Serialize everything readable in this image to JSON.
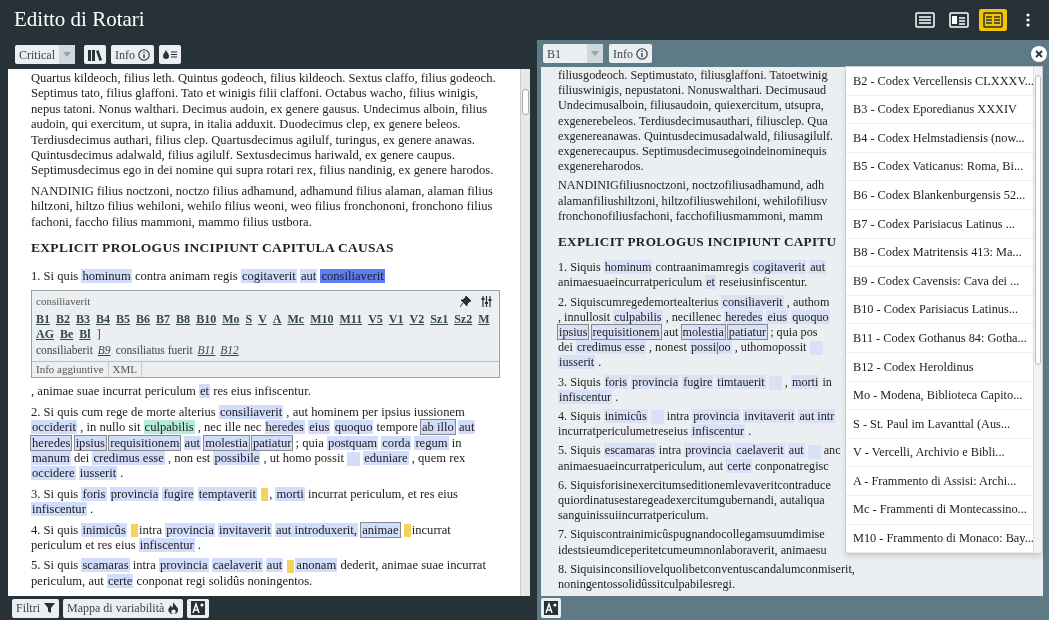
{
  "window": {
    "title": "Editto di Rotari"
  },
  "view_modes": [
    {
      "kind": "text",
      "selected": false
    },
    {
      "kind": "image-text",
      "selected": false
    },
    {
      "kind": "parallel",
      "selected": true
    }
  ],
  "left_panel": {
    "edition_select": "Critical",
    "info_button": "Info",
    "paragraphs": [
      {
        "kind": "para",
        "segments": [
          {
            "kind": "plain",
            "text": "Quartus kildeoch, filius leth. Quintus godeoch, filius kildeoch. Sextus claffo, filius godeoch. Septimus tato, filius glaffoni. Tato et winigis filii claffoni. Octabus wacho, filius winigis, nepus tatoni. Nonus walthari. Decimus audoin, ex genere gausus. Undecimus alboin, filius audoin, qui exercitum, ut supra, in italia adduxit. Duodecimus clep, ex genere beleos. Terdiusdecimus authari, filius clep. Quartusdecimus agilulf, turingus, ex genere anawas. Quintusdecimus adalwald, filius agilulf. Sextusdecimus hariwald, ex genere caupus. Septimusdecimus ego in dei nomine qui supra rotari rex, filius nandinig, ex genere harodos."
          }
        ]
      },
      {
        "kind": "para",
        "segments": [
          {
            "kind": "plain",
            "text": "NANDINIG filius noctzoni, noctzo filius adhamund, adhamund filius alaman, alaman filius hiltzoni, hiltzo filius wehiloni, wehilo filius weoni, weo filius fronchononi, fronchono filius fachoni, faccho filius mammoni, mammo filius ustbora."
          }
        ]
      },
      {
        "kind": "heading",
        "segments": [
          {
            "kind": "plain",
            "text": "EXPLICIT PROLOGUS INCIPIUNT CAPITULA CAUSAS"
          }
        ]
      },
      {
        "kind": "para",
        "segments": [
          {
            "kind": "plain",
            "text": "1. Si quis "
          },
          {
            "kind": "hl",
            "text": "hominum"
          },
          {
            "kind": "plain",
            "text": " contra animam regis "
          },
          {
            "kind": "hl",
            "text": "cogitaverit"
          },
          {
            "kind": "space"
          },
          {
            "kind": "hl",
            "text": "aut"
          },
          {
            "kind": "space"
          },
          {
            "kind": "selected",
            "text": "consiliaverit"
          }
        ]
      },
      {
        "kind": "popup"
      },
      {
        "kind": "para",
        "segments": [
          {
            "kind": "plain",
            "text": ", animae suae incurrat periculum "
          },
          {
            "kind": "hl",
            "text": "et"
          },
          {
            "kind": "plain",
            "text": " res eius infiscentur."
          }
        ]
      },
      {
        "kind": "para",
        "segments": [
          {
            "kind": "plain",
            "text": "2. Si quis cum rege de morte alterius "
          },
          {
            "kind": "hl",
            "text": "consiliaverit"
          },
          {
            "kind": "plain",
            "text": " , aut hominem per ipsius iussionem "
          },
          {
            "kind": "hl",
            "text": "occiderit"
          },
          {
            "kind": "plain",
            "text": " , in nullo sit "
          },
          {
            "kind": "green",
            "text": "culpabilis"
          },
          {
            "kind": "plain",
            "text": " , nec ille nec "
          },
          {
            "kind": "hl",
            "text": "heredes"
          },
          {
            "kind": "space"
          },
          {
            "kind": "hl",
            "text": "eius"
          },
          {
            "kind": "space"
          },
          {
            "kind": "hl",
            "text": "quoquo"
          },
          {
            "kind": "plain",
            "text": " tempore "
          },
          {
            "kind": "boxed",
            "text": "ab illo"
          },
          {
            "kind": "space"
          },
          {
            "kind": "hl",
            "text": "aut"
          },
          {
            "kind": "space"
          },
          {
            "kind": "boxed",
            "text": "heredes"
          },
          {
            "kind": "space"
          },
          {
            "kind": "boxed",
            "text": "ipsius"
          },
          {
            "kind": "space"
          },
          {
            "kind": "boxed",
            "text": "requisitionem"
          },
          {
            "kind": "space"
          },
          {
            "kind": "hl",
            "text": "aut"
          },
          {
            "kind": "space"
          },
          {
            "kind": "boxed",
            "text": "molestia"
          },
          {
            "kind": "space"
          },
          {
            "kind": "boxed",
            "text": "patiatur"
          },
          {
            "kind": "plain",
            "text": " ; quia "
          },
          {
            "kind": "hl",
            "text": "postquam"
          },
          {
            "kind": "space"
          },
          {
            "kind": "hl",
            "text": "corda"
          },
          {
            "kind": "space"
          },
          {
            "kind": "hl",
            "text": "regum"
          },
          {
            "kind": "plain",
            "text": " in "
          },
          {
            "kind": "hl",
            "text": "manum"
          },
          {
            "kind": "plain",
            "text": " dei "
          },
          {
            "kind": "hl",
            "text": "credimus esse"
          },
          {
            "kind": "plain",
            "text": " , non est "
          },
          {
            "kind": "hl",
            "text": "possibile"
          },
          {
            "kind": "plain",
            "text": " , ut homo possit "
          },
          {
            "kind": "gap"
          },
          {
            "kind": "space"
          },
          {
            "kind": "hl",
            "text": "eduniare"
          },
          {
            "kind": "plain",
            "text": " , quem rex "
          },
          {
            "kind": "hl",
            "text": "occidere"
          },
          {
            "kind": "space"
          },
          {
            "kind": "hl",
            "text": "iusserit"
          },
          {
            "kind": "plain",
            "text": " ."
          }
        ]
      },
      {
        "kind": "para",
        "segments": [
          {
            "kind": "plain",
            "text": "3. Si quis "
          },
          {
            "kind": "hl",
            "text": "foris"
          },
          {
            "kind": "space"
          },
          {
            "kind": "hl",
            "text": "provincia"
          },
          {
            "kind": "space"
          },
          {
            "kind": "hl",
            "text": "fugire"
          },
          {
            "kind": "space"
          },
          {
            "kind": "hl",
            "text": "temptaverit"
          },
          {
            "kind": "space"
          },
          {
            "kind": "mark"
          },
          {
            "kind": "plain",
            "text": ", "
          },
          {
            "kind": "hl",
            "text": "morti"
          },
          {
            "kind": "plain",
            "text": " incurrat periculum, et res eius "
          },
          {
            "kind": "hl",
            "text": "infiscentur"
          },
          {
            "kind": "plain",
            "text": " ."
          }
        ]
      },
      {
        "kind": "para",
        "segments": [
          {
            "kind": "plain",
            "text": "4. Si quis "
          },
          {
            "kind": "hl",
            "text": "inimicûs"
          },
          {
            "kind": "space"
          },
          {
            "kind": "mark"
          },
          {
            "kind": "plain",
            "text": "intra "
          },
          {
            "kind": "hl",
            "text": "provincia"
          },
          {
            "kind": "space"
          },
          {
            "kind": "hl",
            "text": "invitaverit"
          },
          {
            "kind": "space"
          },
          {
            "kind": "hl",
            "text": "aut introduxerit,"
          },
          {
            "kind": "space"
          },
          {
            "kind": "boxed",
            "text": "animae"
          },
          {
            "kind": "space"
          },
          {
            "kind": "mark"
          },
          {
            "kind": "plain",
            "text": "incurrat periculum et res eius "
          },
          {
            "kind": "hl",
            "text": "infiscentur"
          },
          {
            "kind": "plain",
            "text": " ."
          }
        ]
      },
      {
        "kind": "para",
        "segments": [
          {
            "kind": "plain",
            "text": "5. Si quis "
          },
          {
            "kind": "hl",
            "text": "scamaras"
          },
          {
            "kind": "plain",
            "text": " intra "
          },
          {
            "kind": "hl",
            "text": "provincia"
          },
          {
            "kind": "space"
          },
          {
            "kind": "hl",
            "text": "caelaverit"
          },
          {
            "kind": "space"
          },
          {
            "kind": "hl",
            "text": "aut"
          },
          {
            "kind": "space"
          },
          {
            "kind": "mark"
          },
          {
            "kind": "hl",
            "text": "anonam"
          },
          {
            "kind": "plain",
            "text": " dederit, animae suae incurrat periculum, aut "
          },
          {
            "kind": "hl",
            "text": "certe"
          },
          {
            "kind": "plain",
            "text": " conponat regi solidûs noningentos."
          }
        ]
      }
    ],
    "popup": {
      "lemma": "consiliaverit",
      "witnesses": [
        "B1",
        "B2",
        "B3",
        "B4",
        "B5",
        "B6",
        "B7",
        "B8",
        "B10",
        "Mo",
        "S",
        "V",
        "A",
        "Mc",
        "M10",
        "M11",
        "V5",
        "V1",
        "V2",
        "Sz1",
        "Sz2",
        "M",
        "AG",
        "Be",
        "Bl"
      ],
      "bracket": "]",
      "variants": [
        {
          "kind": "reading",
          "text": "consiliaberit"
        },
        {
          "kind": "siglum",
          "text": "B9"
        },
        {
          "kind": "reading",
          "text": "consiliatus fuerit"
        },
        {
          "kind": "siglum",
          "text": "B11"
        },
        {
          "kind": "siglum",
          "text": "B12"
        }
      ],
      "tabs": [
        {
          "label": "Info aggiuntive",
          "selected": false
        },
        {
          "label": "XML",
          "selected": false
        }
      ]
    },
    "footer_buttons": [
      {
        "kind": "filter",
        "label": "Filtri"
      },
      {
        "kind": "heatmap",
        "label": "Mappa di variabilità"
      },
      {
        "kind": "font"
      }
    ]
  },
  "right_panel": {
    "witness_select": "B1",
    "info_button": "Info",
    "paragraphs": [
      {
        "kind": "para",
        "lines": [
          [
            {
              "kind": "plain",
              "text": "filiusgodeoch. Septimustato, filiusglaffoni. Tatoetwinig"
            }
          ],
          [
            {
              "kind": "plain",
              "text": "filiuswinigis, nepustatoni. Nonuswalthari. Decimusaud"
            }
          ],
          [
            {
              "kind": "plain",
              "text": "Undecimusalboin, filiusaudoin, quiexercitum, utsupra,"
            }
          ],
          [
            {
              "kind": "plain",
              "text": "exgenerebeleos. Terdiusdecimusauthari, filiusclep. Qua"
            }
          ],
          [
            {
              "kind": "plain",
              "text": "exgenereanawas. Quintusdecimusadalwald, filiusagilulf."
            }
          ],
          [
            {
              "kind": "plain",
              "text": "exgenerecaupus. Septimusdecimusegoindeinominequis"
            }
          ],
          [
            {
              "kind": "plain",
              "text": "exgenereharodos."
            }
          ]
        ]
      },
      {
        "kind": "para",
        "lines": [
          [
            {
              "kind": "plain",
              "text": "NANDINIGfiliusnoctzoni, noctzofiliusadhamund, adh"
            }
          ],
          [
            {
              "kind": "plain",
              "text": "alamanfiliushiltzoni, hiltzofiliuswehiloni, wehilofiliusv"
            }
          ],
          [
            {
              "kind": "plain",
              "text": "fronchonofiliusfachoni, facchofiliusmammoni, mamm"
            }
          ]
        ]
      },
      {
        "kind": "heading",
        "lines": [
          [
            {
              "kind": "plain",
              "text": "EXPLICIT PROLOGUS INCIPIUNT CAPITU"
            }
          ]
        ]
      },
      {
        "kind": "para",
        "lines": [
          [
            {
              "kind": "plain",
              "text": "1. Siquis "
            },
            {
              "kind": "hl",
              "text": "hominum"
            },
            {
              "kind": "plain",
              "text": " contraanimamregis "
            },
            {
              "kind": "hl",
              "text": "cogitaverit"
            },
            {
              "kind": "space"
            },
            {
              "kind": "hl",
              "text": "aut"
            }
          ],
          [
            {
              "kind": "plain",
              "text": "animaesuaeincurratpericulum "
            },
            {
              "kind": "hl",
              "text": "et"
            },
            {
              "kind": "plain",
              "text": " reseiusinfiscentur."
            }
          ]
        ]
      },
      {
        "kind": "para",
        "lines": [
          [
            {
              "kind": "plain",
              "text": "2. Siquiscumregedemortealterius "
            },
            {
              "kind": "hl",
              "text": "consiliaverit"
            },
            {
              "kind": "plain",
              "text": " , authom"
            }
          ],
          [
            {
              "kind": "plain",
              "text": ", innullosit "
            },
            {
              "kind": "hl",
              "text": "culpabilis"
            },
            {
              "kind": "plain",
              "text": " , necillenec "
            },
            {
              "kind": "hl",
              "text": "heredes"
            },
            {
              "kind": "space"
            },
            {
              "kind": "hl",
              "text": "eius"
            },
            {
              "kind": "space"
            },
            {
              "kind": "hl",
              "text": "quoquo"
            }
          ],
          [
            {
              "kind": "boxed",
              "text": "ipsius"
            },
            {
              "kind": "space"
            },
            {
              "kind": "boxed",
              "text": "requisitionem"
            },
            {
              "kind": "plain",
              "text": " aut "
            },
            {
              "kind": "boxed",
              "text": "molestia"
            },
            {
              "kind": "space"
            },
            {
              "kind": "boxed",
              "text": "patiatur"
            },
            {
              "kind": "plain",
              "text": " ; quia pos"
            }
          ],
          [
            {
              "kind": "plain",
              "text": "dei "
            },
            {
              "kind": "hl",
              "text": "credimus esse"
            },
            {
              "kind": "plain",
              "text": " , nonest "
            },
            {
              "kind": "hl",
              "text": "possi|oo"
            },
            {
              "kind": "plain",
              "text": " , uthomopossit "
            },
            {
              "kind": "gap"
            }
          ],
          [
            {
              "kind": "hl",
              "text": "iusserit"
            },
            {
              "kind": "plain",
              "text": " ."
            }
          ]
        ]
      },
      {
        "kind": "para",
        "lines": [
          [
            {
              "kind": "plain",
              "text": "3. Siquis "
            },
            {
              "kind": "hl",
              "text": "foris"
            },
            {
              "kind": "space"
            },
            {
              "kind": "hl",
              "text": "provincia"
            },
            {
              "kind": "space"
            },
            {
              "kind": "hl",
              "text": "fugire"
            },
            {
              "kind": "space"
            },
            {
              "kind": "hl",
              "text": "timtauerit"
            },
            {
              "kind": "space"
            },
            {
              "kind": "gap"
            },
            {
              "kind": "plain",
              "text": " , "
            },
            {
              "kind": "hl",
              "text": "morti"
            },
            {
              "kind": "plain",
              "text": " in"
            }
          ],
          [
            {
              "kind": "hl",
              "text": "infiscentur"
            },
            {
              "kind": "plain",
              "text": " ."
            }
          ]
        ]
      },
      {
        "kind": "para",
        "lines": [
          [
            {
              "kind": "plain",
              "text": "4. Siquis "
            },
            {
              "kind": "hl",
              "text": "inimicûs"
            },
            {
              "kind": "space"
            },
            {
              "kind": "gap"
            },
            {
              "kind": "plain",
              "text": " intra "
            },
            {
              "kind": "hl",
              "text": "provincia"
            },
            {
              "kind": "space"
            },
            {
              "kind": "hl",
              "text": "invitaverit"
            },
            {
              "kind": "space"
            },
            {
              "kind": "hl",
              "text": "aut intr"
            }
          ],
          [
            {
              "kind": "plain",
              "text": "incurratpericulumetreseius "
            },
            {
              "kind": "hl",
              "text": "infiscentur"
            },
            {
              "kind": "plain",
              "text": " ."
            }
          ]
        ]
      },
      {
        "kind": "para",
        "lines": [
          [
            {
              "kind": "plain",
              "text": "5. Siquis "
            },
            {
              "kind": "hl",
              "text": "escamaras"
            },
            {
              "kind": "plain",
              "text": " intra "
            },
            {
              "kind": "hl",
              "text": "provincia"
            },
            {
              "kind": "space"
            },
            {
              "kind": "hl",
              "text": "caelaverit"
            },
            {
              "kind": "space"
            },
            {
              "kind": "hl",
              "text": "aut"
            },
            {
              "kind": "space"
            },
            {
              "kind": "gap"
            },
            {
              "kind": "plain",
              "text": " anc"
            }
          ],
          [
            {
              "kind": "plain",
              "text": "animaesuaeincurratpericulum, aut "
            },
            {
              "kind": "hl",
              "text": "certe"
            },
            {
              "kind": "plain",
              "text": " conponatregisc"
            }
          ]
        ]
      },
      {
        "kind": "para",
        "lines": [
          [
            {
              "kind": "plain",
              "text": "6. Siquisforisinexercitumseditionemlevaveritcontraduce"
            }
          ],
          [
            {
              "kind": "plain",
              "text": "quiordinatusestaregeadexercitumgubernandi, autaliqua"
            }
          ],
          [
            {
              "kind": "plain",
              "text": "sanguinissuiincurratpericulum."
            }
          ]
        ]
      },
      {
        "kind": "para",
        "lines": [
          [
            {
              "kind": "plain",
              "text": "7. Siquiscontrainimicûspugnandocollegamsuumdimise"
            }
          ],
          [
            {
              "kind": "plain",
              "text": "idestsieumdiceperitetcumeumnonlaboraverit, animaesu"
            }
          ]
        ]
      },
      {
        "kind": "para",
        "lines": [
          [
            {
              "kind": "plain",
              "text": "8. Siquisinconsiliovelquolibetconventuscandalumconmiserit,"
            }
          ],
          [
            {
              "kind": "plain",
              "text": "noningentossolidûssitculpabilesregi."
            }
          ]
        ]
      }
    ],
    "witness_dropdown": [
      {
        "label": "B2 - Codex Vercellensis CLXXXV...",
        "selected": false
      },
      {
        "label": "B3 - Codex Eporedianus XXXIV",
        "selected": false
      },
      {
        "label": "B4 - Codex Helmstadiensis (now...",
        "selected": false
      },
      {
        "label": "B5 - Codex Vaticanus: Roma, Bi...",
        "selected": false
      },
      {
        "label": "B6 - Codex Blankenburgensis 52...",
        "selected": false
      },
      {
        "label": "B7 - Codex Parisiacus Latinus ...",
        "selected": false
      },
      {
        "label": "B8 - Codex Matritensis 413: Ma...",
        "selected": false
      },
      {
        "label": "B9 - Codex Cavensis: Cava dei ...",
        "selected": false
      },
      {
        "label": "B10 - Codex Parisiacus Latinus...",
        "selected": false
      },
      {
        "label": "B11 - Codex Gothanus 84: Gotha...",
        "selected": false
      },
      {
        "label": "B12 - Codex Heroldinus",
        "selected": false
      },
      {
        "label": "Mo - Modena, Biblioteca Capito...",
        "selected": false
      },
      {
        "label": "S - St. Paul im Lavanttal (Aus...",
        "selected": false
      },
      {
        "label": "V - Vercelli, Archivio e Bibli...",
        "selected": false
      },
      {
        "label": "A - Frammento di Assisi: Archi...",
        "selected": false
      },
      {
        "label": "Mc - Frammenti di Montecassino...",
        "selected": false
      },
      {
        "label": "M10 - Frammento di Monaco: Bay...",
        "selected": false
      }
    ]
  }
}
